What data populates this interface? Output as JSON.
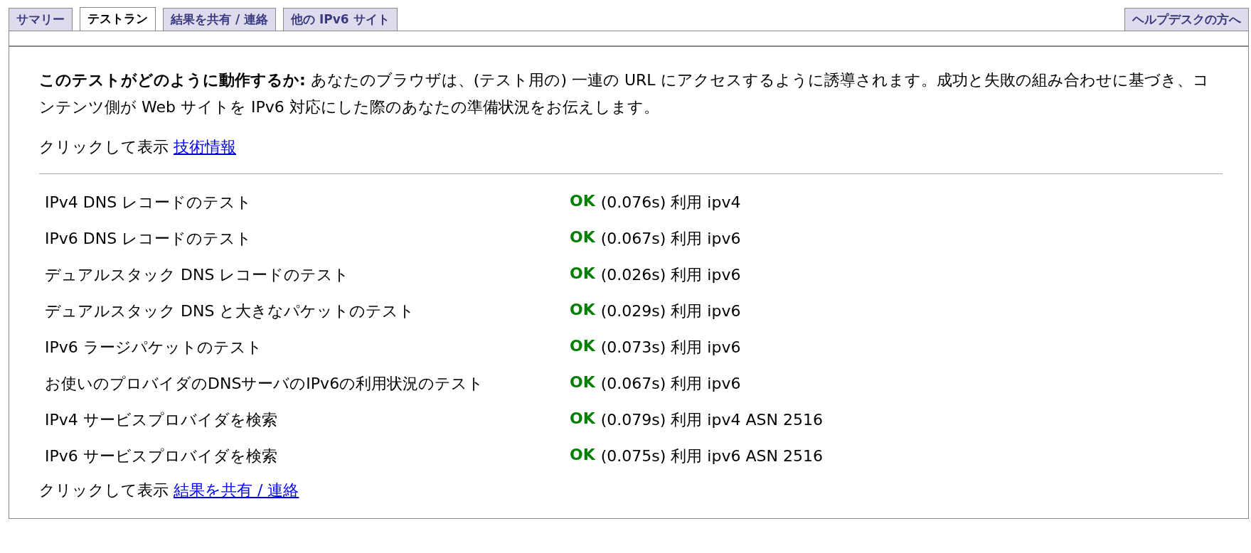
{
  "tabs": [
    {
      "label": "サマリー",
      "selected": false
    },
    {
      "label": "テストラン",
      "selected": true
    },
    {
      "label": "結果を共有 / 連絡",
      "selected": false
    },
    {
      "label": "他の IPv6 サイト",
      "selected": false
    }
  ],
  "help_tab": {
    "label": "ヘルプデスクの方へ",
    "selected": false
  },
  "intro": "**このテストがどのように動作するか:** あなたのブラウザは、(テスト用の) 一連の URL にアクセスするように誘導されます。成功と失敗の組み合わせに基づき、コンテンツ側が Web サイトを IPv6 対応にした際のあなたの準備状況をお伝えします。",
  "tech_info": {
    "prefix": "クリックして表示",
    "link": "技術情報"
  },
  "tests": [
    {
      "name": "IPv4 DNS レコードのテスト",
      "status": "OK",
      "kind": "ok",
      "detail": "(0.076s) 利用 ipv4"
    },
    {
      "name": "IPv6 DNS レコードのテスト",
      "status": "OK",
      "kind": "ok",
      "detail": "(0.067s) 利用 ipv6"
    },
    {
      "name": "デュアルスタック DNS レコードのテスト",
      "status": "OK",
      "kind": "ok",
      "detail": "(0.026s) 利用 ipv6"
    },
    {
      "name": "デュアルスタック DNS と大きなパケットのテスト",
      "status": "OK",
      "kind": "ok",
      "detail": "(0.029s) 利用 ipv6"
    },
    {
      "name": "IPv6 ラージパケットのテスト",
      "status": "OK",
      "kind": "ok",
      "detail": "(0.073s) 利用 ipv6"
    },
    {
      "name": "お使いのプロバイダのDNSサーバのIPv6の利用状況のテスト",
      "status": "OK",
      "kind": "ok",
      "detail": "(0.067s) 利用 ipv6"
    },
    {
      "name": "IPv4 サービスプロバイダを検索",
      "status": "OK",
      "kind": "ok",
      "detail": "(0.079s) 利用 ipv4 ASN 2516"
    },
    {
      "name": "IPv6 サービスプロバイダを検索",
      "status": "OK",
      "kind": "ok",
      "detail": "(0.075s) 利用 ipv6 ASN 2516"
    }
  ],
  "share": {
    "prefix": "クリックして表示",
    "link": "結果を共有 / 連絡"
  }
}
